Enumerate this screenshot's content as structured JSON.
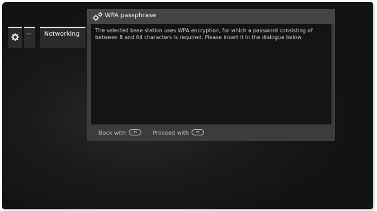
{
  "breadcrumb": {
    "dots_label": "···",
    "networking_label": "Networking",
    "icon": "gear-icon"
  },
  "dialog": {
    "title": "WPA passphrase",
    "icon": "gears-icon",
    "message": "The selected base station uses WPA encryption, for which a password consisting of between 8 and 64 characters is required. Please insert it in the dialogue below.",
    "footer": {
      "back_label": "Back with",
      "back_key": "rewind-key-icon",
      "proceed_label": "Proceed with",
      "proceed_key": "fast-forward-key-icon"
    }
  },
  "colors": {
    "screen_bg": "#1a1a1a",
    "dialog_bg": "#3c3c3c",
    "dialog_body_bg": "#141414",
    "text": "#cfcfcf"
  }
}
